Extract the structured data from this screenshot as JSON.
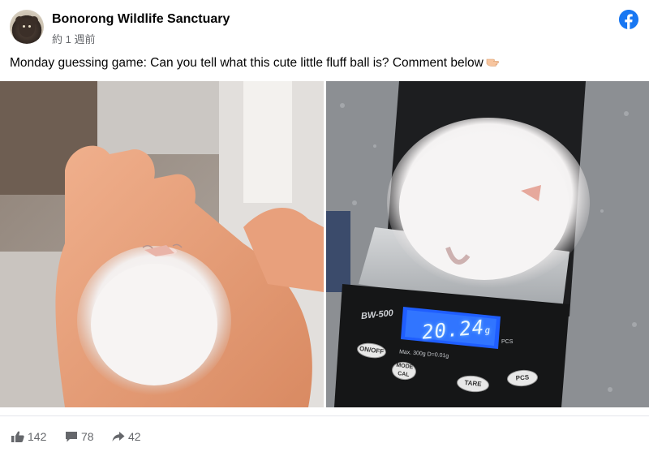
{
  "post": {
    "page_name": "Bonorong Wildlife Sanctuary",
    "time": "約 1 週前",
    "text": "Monday guessing game: Can you tell what this cute little fluff ball is? Comment below",
    "brand_color": "#1877f2"
  },
  "photo_scale": {
    "model": "BW-500",
    "display": "20.24",
    "unit": "g",
    "spec": "Max. 300g  D=0.01g",
    "pcs_small": "PCS",
    "buttons": {
      "on_off": "ON/OFF",
      "mode_cal": "MODE CAL",
      "tare": "TARE",
      "pcs": "PCS"
    }
  },
  "stats": {
    "likes": "142",
    "comments": "78",
    "shares": "42"
  },
  "icons": [
    "facebook-logo-icon",
    "pointing-hand-emoji",
    "like-icon",
    "comment-icon",
    "share-icon"
  ]
}
